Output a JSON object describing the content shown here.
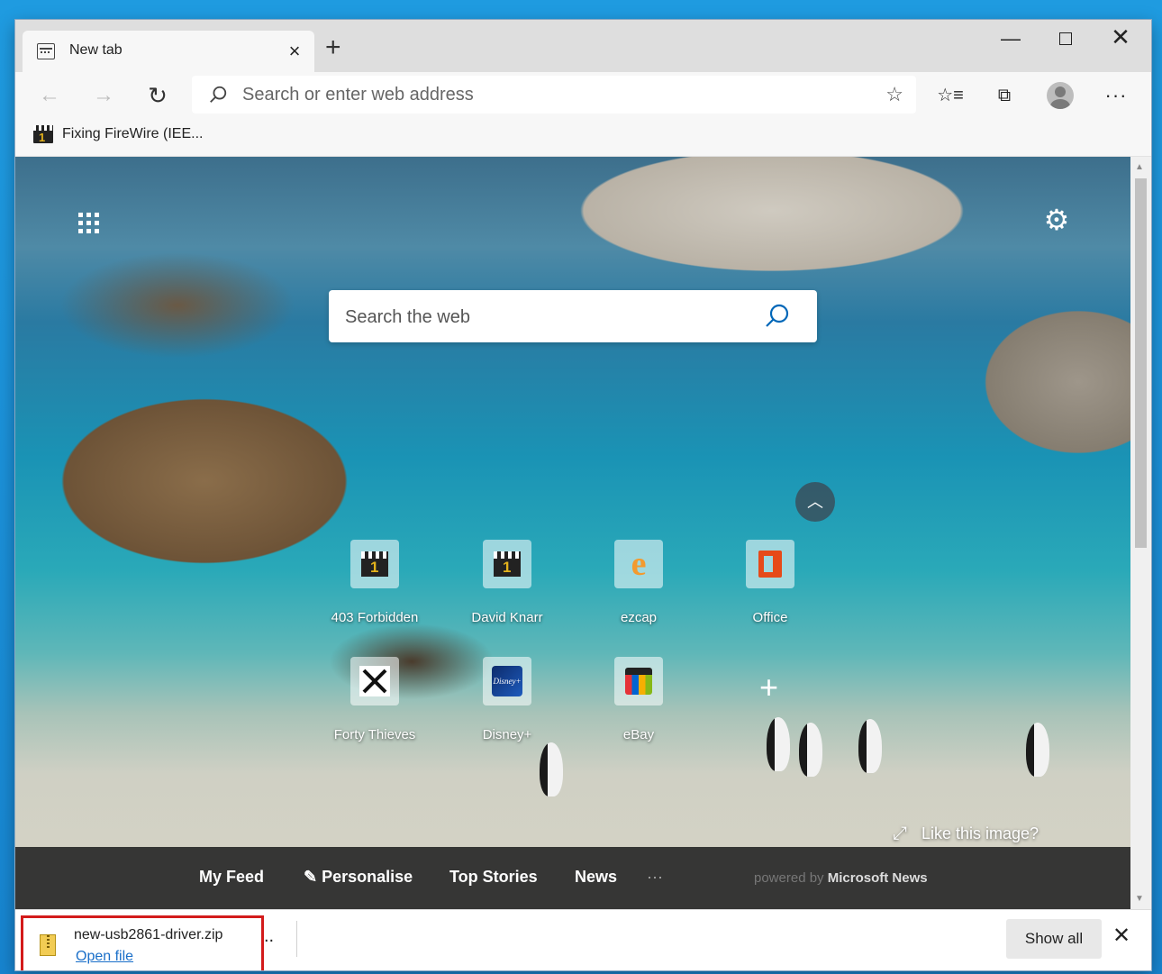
{
  "tab": {
    "title": "New tab",
    "close": "×"
  },
  "newtab": "+",
  "window_controls": {
    "minimize": "—",
    "close": "✕"
  },
  "toolbar": {
    "back": "←",
    "forward": "→",
    "refresh": "↻",
    "address_placeholder": "Search or enter web address",
    "favorite_star": "☆",
    "favorites": "☆≡",
    "collections": "⧉",
    "more": "···"
  },
  "favorites_bar": {
    "items": [
      {
        "label": "Fixing FireWire (IEE..."
      }
    ]
  },
  "newtab_page": {
    "search_placeholder": "Search the web",
    "settings": "⚙",
    "collapse": "︿",
    "tiles": [
      {
        "label": "403 Forbidden",
        "icon": "clapperboard-icon"
      },
      {
        "label": "David Knarr",
        "icon": "clapperboard-icon"
      },
      {
        "label": "ezcap",
        "icon": "ezcap-e-icon"
      },
      {
        "label": "Office",
        "icon": "office-icon"
      },
      {
        "label": "Forty Thieves",
        "icon": "crossed-swords-icon"
      },
      {
        "label": "Disney+",
        "icon": "disney-icon"
      },
      {
        "label": "eBay",
        "icon": "ebay-bag-icon"
      }
    ],
    "disney_logo_text": "Disney+",
    "add_tile": "+",
    "like_image": "Like this image?",
    "expand": "⤢",
    "feed": {
      "my_feed": "My Feed",
      "personalise": "✎ Personalise",
      "top_stories": "Top Stories",
      "news": "News",
      "more": "···",
      "powered_by": "powered by",
      "provider": "Microsoft News"
    }
  },
  "scrollbar": {
    "up": "▲",
    "down": "▼"
  },
  "download_bar": {
    "file_name": "new-usb2861-driver.zip",
    "open_file": "Open file",
    "more": "..",
    "show_all": "Show all",
    "close": "✕"
  },
  "colors": {
    "highlight_border": "#d31b1b",
    "link": "#1a6fc9",
    "desktop": "#1b8fd8"
  }
}
